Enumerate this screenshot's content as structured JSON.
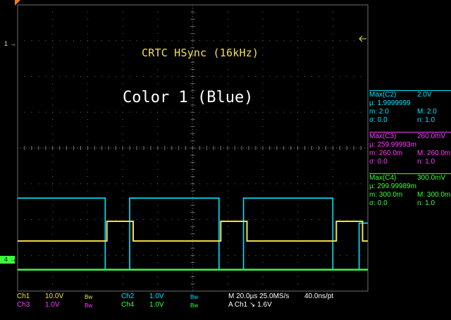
{
  "overlay": {
    "trace_label": "CRTC HSync (16kHz)",
    "title": "Color 1 (Blue)"
  },
  "channel_markers": {
    "ch1": "1",
    "ch4": "4"
  },
  "measurements": [
    {
      "title": "Max(C2)",
      "title_value": "2.0V",
      "mean": "µ: 1.9999999",
      "min": "m: 2.0",
      "max": "M: 2.0",
      "sigma": "σ: 0.0",
      "n": "n: 1.0",
      "color": "#00e5ff"
    },
    {
      "title": "Max(C3)",
      "title_value": "260.0mV",
      "mean": "µ: 259.99993m",
      "min": "m: 260.0m",
      "max": "M: 260.0m",
      "sigma": "σ: 0.0",
      "n": "n: 1.0",
      "color": "#ff3cff"
    },
    {
      "title": "Max(C4)",
      "title_value": "300.0mV",
      "mean": "µ: 299.99989m",
      "min": "m: 300.0m",
      "max": "M: 300.0m",
      "sigma": "σ: 0.0",
      "n": "n: 1.0",
      "color": "#3cff3c"
    }
  ],
  "status": {
    "ch1_label": "Ch1",
    "ch1_scale": "10.0V",
    "ch1_bw": "Bw",
    "ch2_label": "Ch2",
    "ch2_scale": "1.0V",
    "ch2_bw": "Bw",
    "ch3_label": "Ch3",
    "ch3_scale": "1.0V",
    "ch3_bw": "Bw",
    "ch4_label": "Ch4",
    "ch4_scale": "1.0V",
    "ch4_bw": "Bw",
    "timebase": "M 20.0µs 25.0MS/s",
    "resolution": "40.0ns/pt",
    "trigger": "A  Ch1  ↘  1.6V"
  },
  "colors": {
    "ch1": "#f2e24a",
    "ch2": "#00e5ff",
    "ch3": "#ff3cff",
    "ch4": "#3cff3c",
    "grid": "#6e6e6e",
    "trigger_marker": "#f07820"
  },
  "chart_data": {
    "type": "line",
    "xlabel": "",
    "ylabel": "",
    "x_divisions": 10,
    "y_divisions": 8,
    "series": [
      {
        "name": "Ch1",
        "points": [
          [
            0,
            0
          ],
          [
            2.55,
            0
          ],
          [
            2.55,
            0.55
          ],
          [
            3.3,
            0.55
          ],
          [
            3.3,
            0
          ],
          [
            5.8,
            0
          ],
          [
            5.8,
            0.55
          ],
          [
            6.55,
            0.55
          ],
          [
            6.55,
            0
          ],
          [
            9.1,
            0
          ],
          [
            9.1,
            0.55
          ],
          [
            9.85,
            0.55
          ],
          [
            9.85,
            0
          ],
          [
            10,
            0
          ]
        ]
      },
      {
        "name": "Ch2",
        "points": [
          [
            0,
            2.0
          ],
          [
            2.5,
            2.0
          ],
          [
            2.5,
            0
          ],
          [
            3.2,
            0
          ],
          [
            3.2,
            2.0
          ],
          [
            5.75,
            2.0
          ],
          [
            5.75,
            0
          ],
          [
            6.45,
            0
          ],
          [
            6.45,
            2.0
          ],
          [
            9.0,
            2.0
          ],
          [
            9.0,
            0
          ],
          [
            9.75,
            0
          ],
          [
            9.75,
            1.3
          ],
          [
            10,
            1.3
          ]
        ]
      },
      {
        "name": "Ch3",
        "points": [
          [
            0,
            0
          ],
          [
            10,
            0
          ]
        ]
      },
      {
        "name": "Ch4",
        "points": [
          [
            0,
            0
          ],
          [
            10,
            0
          ]
        ]
      }
    ]
  }
}
